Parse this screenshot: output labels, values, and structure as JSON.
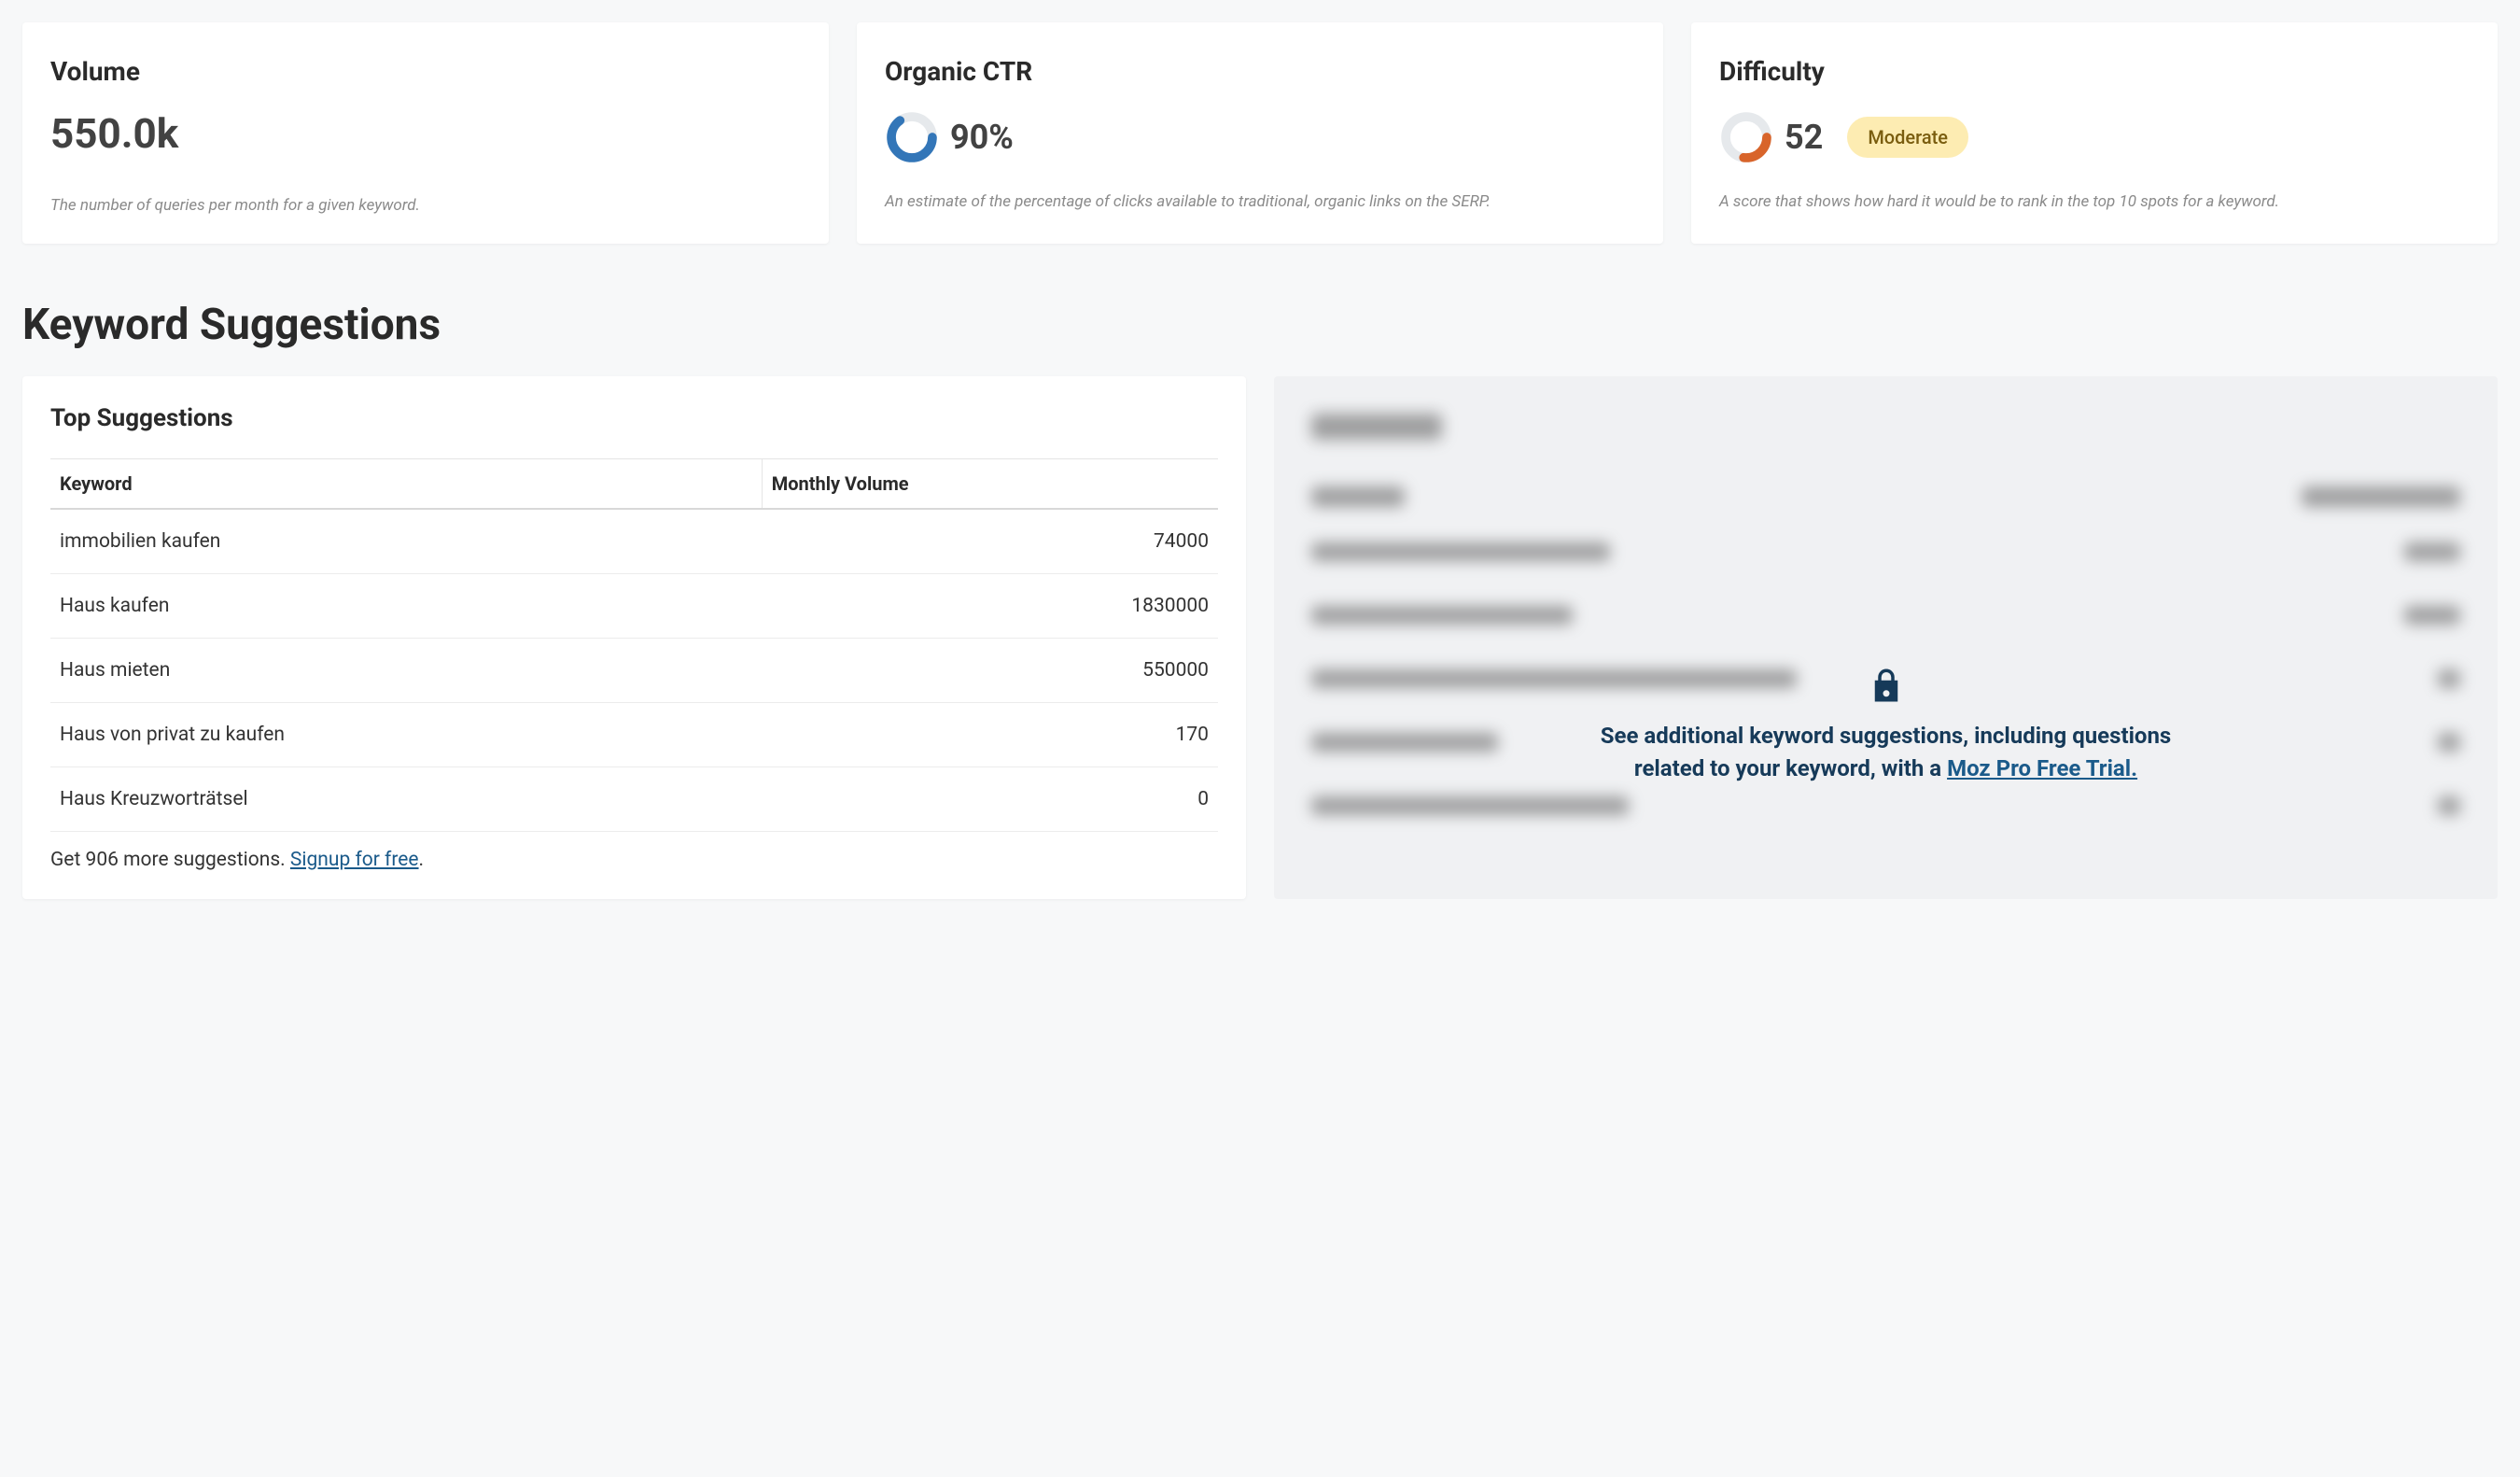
{
  "metrics": {
    "volume": {
      "title": "Volume",
      "value": "550.0k",
      "desc": "The number of queries per month for a given keyword."
    },
    "ctr": {
      "title": "Organic CTR",
      "value": "90%",
      "pct": 90,
      "desc": "An estimate of the percentage of clicks available to traditional, organic links on the SERP."
    },
    "difficulty": {
      "title": "Difficulty",
      "value": "52",
      "pct": 52,
      "badge": "Moderate",
      "desc": "A score that shows how hard it would be to rank in the top 10 spots for a keyword."
    }
  },
  "section_heading": "Keyword Suggestions",
  "suggestions_panel": {
    "title": "Top Suggestions",
    "col_keyword": "Keyword",
    "col_volume": "Monthly Volume",
    "rows": [
      {
        "keyword": "immobilien kaufen",
        "volume": "74000"
      },
      {
        "keyword": "Haus kaufen",
        "volume": "1830000"
      },
      {
        "keyword": "Haus mieten",
        "volume": "550000"
      },
      {
        "keyword": "Haus von privat zu kaufen",
        "volume": "170"
      },
      {
        "keyword": "Haus Kreuzworträtsel",
        "volume": "0"
      }
    ],
    "more_prefix": "Get 906 more suggestions. ",
    "more_link": "Signup for free",
    "more_suffix": "."
  },
  "locked_panel": {
    "text_prefix": "See additional keyword suggestions, including questions related to your keyword, with a ",
    "link": "Moz Pro Free Trial."
  },
  "colors": {
    "ctr_ring": "#3376b8",
    "difficulty_ring": "#d8642a",
    "badge_bg": "#fdecb2",
    "link": "#1a5a8a"
  }
}
